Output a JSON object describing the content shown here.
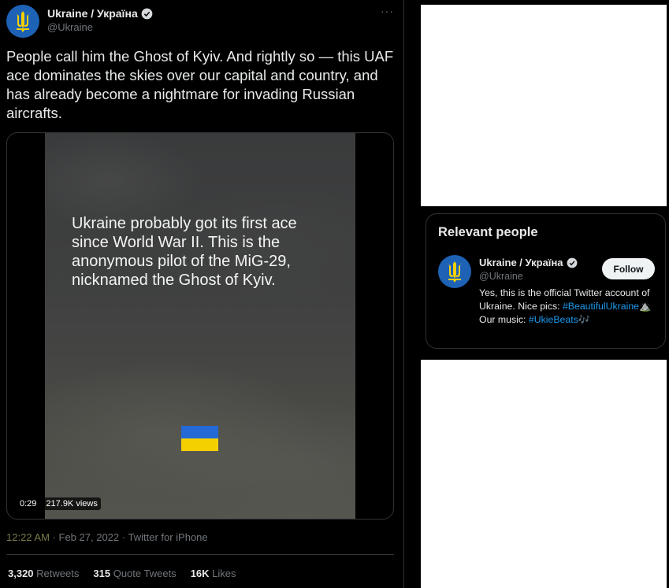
{
  "tweet": {
    "display_name": "Ukraine / Україна",
    "handle": "@Ukraine",
    "more_label": "···",
    "text": "People call him the Ghost of Kyiv. And rightly so — this UAF ace dominates the skies over our capital and country, and has already become a nightmare for invading Russian aircrafts.",
    "video": {
      "caption": "Ukraine probably got its first ace since World War II. This is the anonymous pilot of the MiG-29, nicknamed the Ghost of Kyiv.",
      "duration": "0:29",
      "views": "217.9K views"
    },
    "time": "12:22 AM",
    "date": "Feb 27, 2022",
    "source": "Twitter for iPhone",
    "stats": [
      {
        "count": "3,320",
        "label": "Retweets"
      },
      {
        "count": "315",
        "label": "Quote Tweets"
      },
      {
        "count": "16K",
        "label": "Likes"
      }
    ]
  },
  "relevant_people": {
    "title": "Relevant people",
    "person": {
      "name": "Ukraine / Україна",
      "handle": "@Ukraine",
      "follow_label": "Follow",
      "bio_part1": "Yes, this is the official Twitter account of Ukraine. Nice pics: ",
      "hashtag1": "#BeautifulUkraine",
      "emoji1": "⛰️",
      "bio_part2": " Our music: ",
      "hashtag2": "#UkieBeats",
      "emoji2": "🎶"
    }
  },
  "colors": {
    "background": "#000000",
    "text": "#e7e9ea",
    "muted": "#71767b",
    "link": "#1d9bf0",
    "flag_blue": "#2469d6",
    "flag_yellow": "#f5d000",
    "avatar_bg": "#1d62b5"
  },
  "icons": [
    "trident-icon",
    "verified-badge-icon",
    "more-options-icon"
  ]
}
